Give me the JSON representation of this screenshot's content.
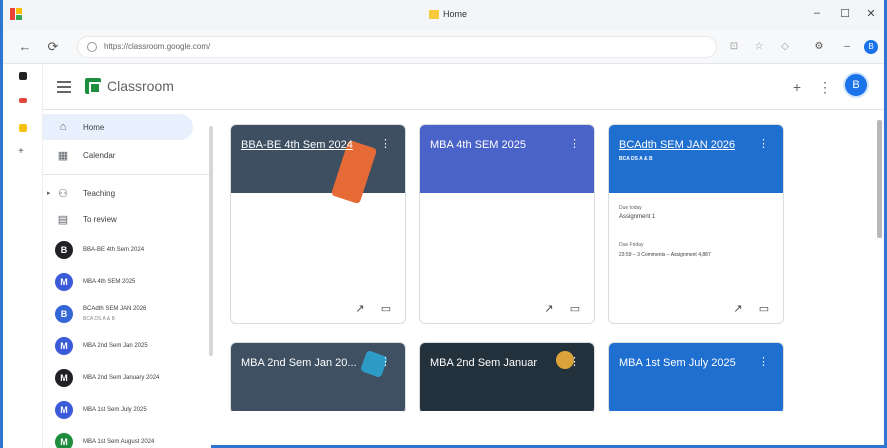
{
  "window": {
    "tab_title": "Home",
    "controls": [
      "–",
      "☐",
      "✕"
    ]
  },
  "browser": {
    "url": "https://classroom.google.com/",
    "nav": [
      "←",
      "⟳"
    ]
  },
  "header": {
    "title": "Classroom",
    "avatar_letter": "B",
    "icons": [
      "plus-icon",
      "apps-grid-icon"
    ]
  },
  "sidebar": {
    "items": [
      {
        "label": "Home",
        "icon": "home-icon",
        "glyph": "⌂",
        "active": true
      },
      {
        "label": "Calendar",
        "icon": "calendar-icon",
        "glyph": "▦",
        "active": false
      },
      {
        "label": "Teaching",
        "icon": "teaching-icon",
        "glyph": "⚇",
        "active": false
      },
      {
        "label": "To review",
        "icon": "review-icon",
        "glyph": "▤",
        "active": false
      }
    ],
    "classes": [
      {
        "letter": "B",
        "label": "BBA-BE 4th Sem 2024",
        "sub": "",
        "color": "#202124"
      },
      {
        "letter": "M",
        "label": "MBA 4th SEM 2025",
        "sub": "",
        "color": "#3c5bd8"
      },
      {
        "letter": "B",
        "label": "BCAdth SEM JAN 2026",
        "sub": "BCA DS A & B",
        "color": "#3367d6"
      },
      {
        "letter": "M",
        "label": "MBA 2nd Sem Jan 2025",
        "sub": "",
        "color": "#3c5bd8"
      },
      {
        "letter": "M",
        "label": "MBA 2nd Sem January 2024",
        "sub": "",
        "color": "#202124"
      },
      {
        "letter": "M",
        "label": "MBA 1st Sem July 2025",
        "sub": "",
        "color": "#3c5bd8"
      },
      {
        "letter": "M",
        "label": "MBA 1st Sem August 2024",
        "sub": "",
        "color": "#1e8e3e"
      }
    ]
  },
  "cards": [
    {
      "title": "BBA-BE 4th Sem 2024",
      "sub": "",
      "color": "#3d4f61",
      "underline": true
    },
    {
      "title": "MBA 4th SEM 2025",
      "sub": "",
      "color": "#4a63c9",
      "underline": false
    },
    {
      "title": "BCAdth SEM JAN 2026",
      "sub": "BCA DS A & B",
      "color": "#1e6fd0",
      "underline": true,
      "due_label": "Due today",
      "due_value": "Assignment 1",
      "due2_label": "Due Friday",
      "due2_value": "23:59 – 3 Comments – Assignment 4,887"
    },
    {
      "title": "MBA 2nd Sem Jan 20...",
      "sub": "",
      "color": "#3e5062",
      "underline": false
    },
    {
      "title": "MBA 2nd Sem Januar",
      "sub": "",
      "color": "#23313d",
      "underline": false
    },
    {
      "title": "MBA 1st Sem July 2025",
      "sub": "",
      "color": "#1e6fd0",
      "underline": false
    }
  ],
  "card_footer_icons": [
    "trending-icon",
    "folder-icon"
  ]
}
